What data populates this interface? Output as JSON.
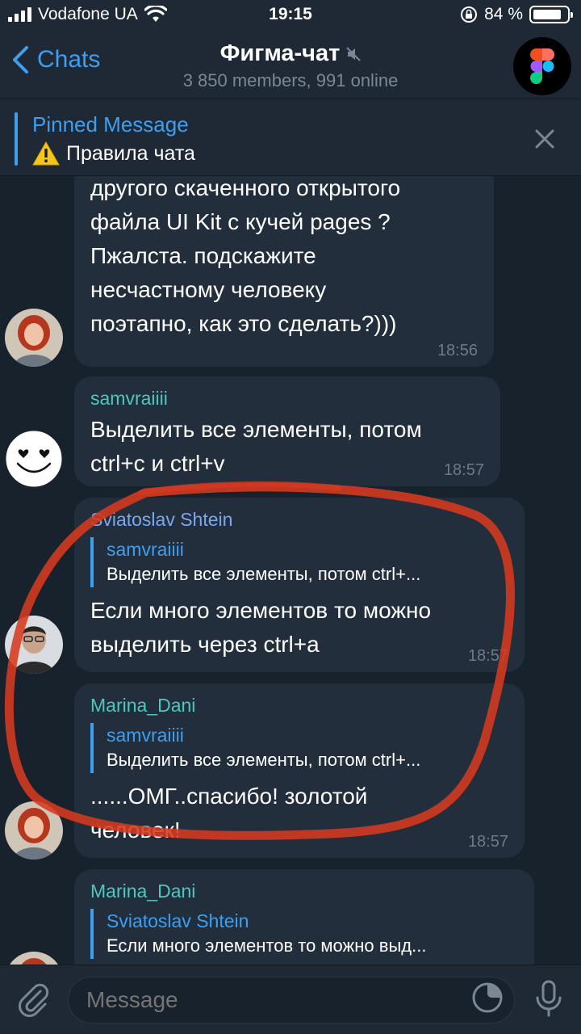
{
  "status_bar": {
    "carrier": "Vodafone UA",
    "time": "19:15",
    "battery_percent": "84 %",
    "battery_level": 0.84
  },
  "nav": {
    "back_label": "Chats",
    "title": "Фигма-чат",
    "subtitle": "3 850 members, 991 online"
  },
  "pinned": {
    "label": "Pinned Message",
    "text": "Правила чата"
  },
  "messages": [
    {
      "lines": [
        "другого скаченного открытого",
        "файла UI Kit с кучей pages ?",
        "Пжалста. подскажите",
        "несчастному человеку",
        "поэтапно, как это сделать?)))"
      ],
      "time": "18:56"
    },
    {
      "sender": "samvraiiii",
      "lines": [
        "Выделить все элементы, потом",
        "ctrl+c и ctrl+v"
      ],
      "time": "18:57"
    },
    {
      "sender": "Sviatoslav Shtein",
      "reply_name": "samvraiiii",
      "reply_text": "Выделить все элементы, потом ctrl+...",
      "lines": [
        "Если много элементов то можно",
        "выделить через ctrl+a"
      ],
      "time": "18:57"
    },
    {
      "sender": "Marina_Dani",
      "reply_name": "samvraiiii",
      "reply_text": "Выделить все элементы, потом ctrl+...",
      "lines": [
        "......ОМГ..спасибо! золотой",
        "человек!"
      ],
      "time": "18:57"
    },
    {
      "sender": "Marina_Dani",
      "reply_name": "Sviatoslav Shtein",
      "reply_text": "Если много элементов то можно выд..."
    }
  ],
  "input": {
    "placeholder": "Message"
  },
  "colors": {
    "background": "#18222d",
    "bubble": "#222e3c",
    "accent": "#3e9ef0",
    "sender_teal": "#4fc6c0",
    "sender_blue": "#7aa8f0",
    "annotation_red": "#d63a1f"
  },
  "icons": [
    "signal-icon",
    "wifi-icon",
    "lock-rotation-icon",
    "battery-icon",
    "back-chevron-icon",
    "mute-icon",
    "figma-logo-icon",
    "warning-icon",
    "close-icon",
    "attach-icon",
    "sticker-icon",
    "microphone-icon"
  ]
}
